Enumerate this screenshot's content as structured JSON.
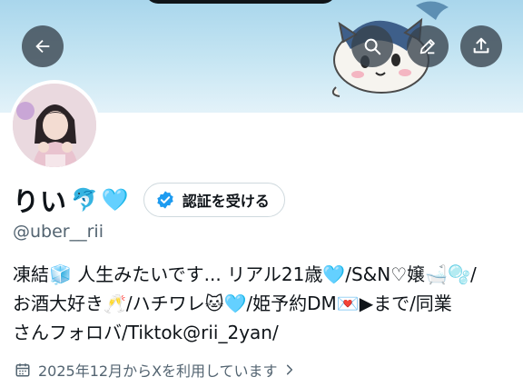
{
  "header": {
    "back_icon": "arrow-left-icon",
    "search_icon": "search-icon",
    "edit_icon": "pencil-icon",
    "share_icon": "share-icon"
  },
  "profile": {
    "display_name": "りい",
    "name_emojis": [
      "🐬",
      "🩵"
    ],
    "verify_button_label": "認証を受ける",
    "handle": "@uber__rii",
    "bio_lines": [
      "凍結🧊 人生みたいです... リアル21歳🩵/S&N♡嬢🛁🫧/",
      "お酒大好き🥂/ハチワレ🐱🩵/姫予約DM💌▶まで/同業",
      "さんフォロバ/Tiktok@rii_2yan/"
    ],
    "joined_text": "2025年12月からXを利用しています"
  },
  "colors": {
    "banner": "#b7deef",
    "verified_blue": "#1d9bf0",
    "secondary_text": "#536471"
  }
}
